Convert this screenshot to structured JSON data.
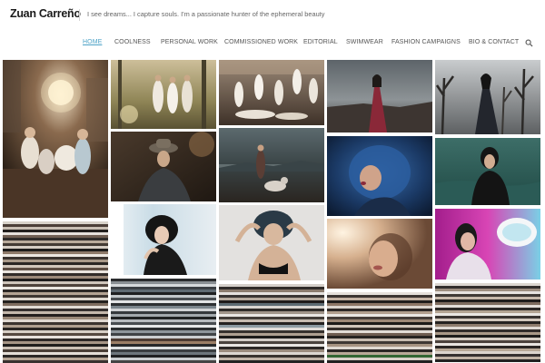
{
  "site": {
    "logo": "Zuan Carreño",
    "tagline": "I see dreams... I capture souls. I'm a passionate hunter of the ephemeral beauty"
  },
  "nav": {
    "items": [
      "HOME",
      "COOLNESS",
      "PERSONAL WORK",
      "COMMISSIONED WORK",
      "EDITORIAL",
      "SWIMWEAR",
      "FASHION CAMPAIGNS",
      "BIO & CONTACT"
    ],
    "active": "HOME",
    "search_icon": "search-icon"
  },
  "colors": {
    "accent": "#4ea3c7",
    "text": "#555555",
    "logo": "#1a1a1a"
  },
  "gallery": {
    "columns": [
      {
        "photos": [
          "children-with-chandelier-photo"
        ]
      },
      {
        "photos": [
          "three-women-forest-photo",
          "woman-in-hat-photo",
          "woman-black-bob-photo"
        ]
      },
      {
        "photos": [
          "dancers-group-photo",
          "woman-with-dog-photo",
          "woman-hands-on-head-photo"
        ]
      },
      {
        "photos": [
          "woman-red-dress-stormy-photo",
          "blue-hair-woman-photo",
          "woman-sunlit-closeup-photo"
        ]
      },
      {
        "photos": [
          "woman-dead-trees-photo",
          "woman-in-water-photo",
          "woman-pink-neon-photo"
        ]
      }
    ]
  }
}
